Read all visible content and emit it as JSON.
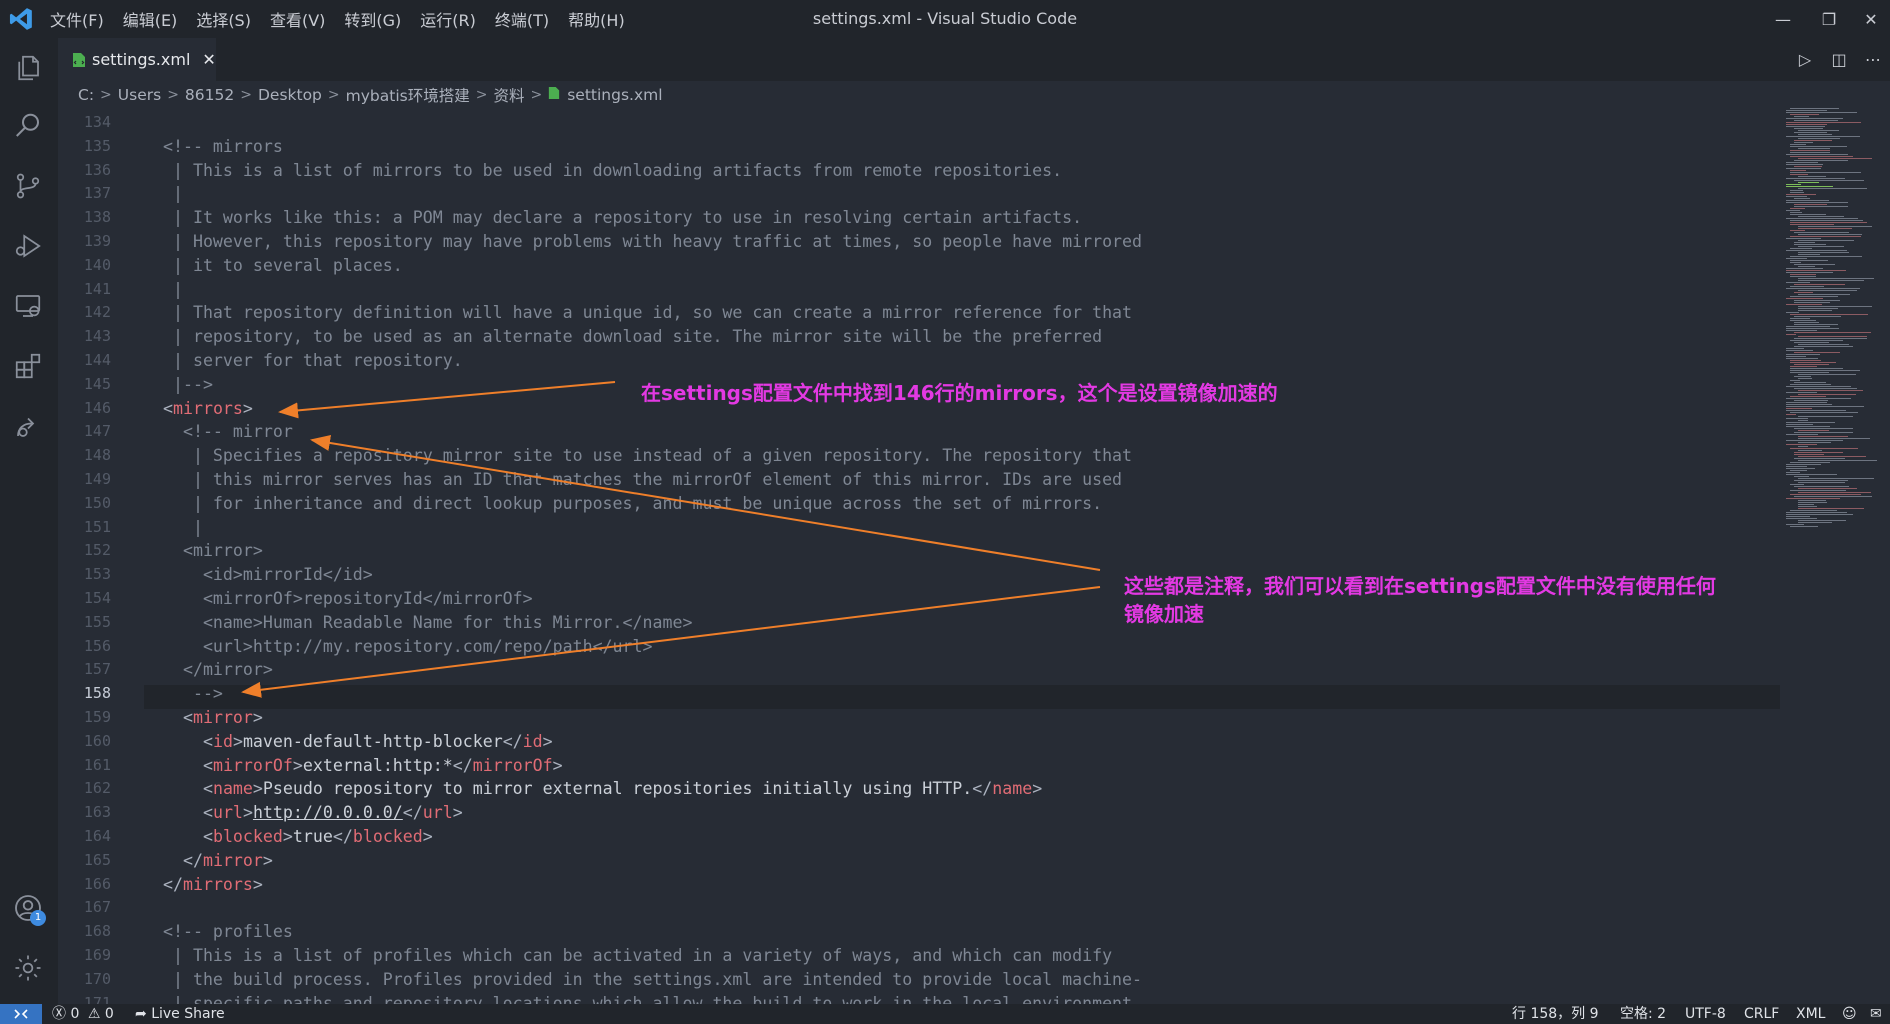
{
  "window": {
    "title": "settings.xml - Visual Studio Code"
  },
  "menu": [
    "文件(F)",
    "编辑(E)",
    "选择(S)",
    "查看(V)",
    "转到(G)",
    "运行(R)",
    "终端(T)",
    "帮助(H)"
  ],
  "tab": {
    "label": "settings.xml"
  },
  "breadcrumb": [
    "C:",
    "Users",
    "86152",
    "Desktop",
    "mybatis环境搭建",
    "资料",
    "settings.xml"
  ],
  "editor": {
    "first_line": 134,
    "current_line": 158,
    "lines": [
      "",
      "  <!-- mirrors",
      "   | This is a list of mirrors to be used in downloading artifacts from remote repositories.",
      "   |",
      "   | It works like this: a POM may declare a repository to use in resolving certain artifacts.",
      "   | However, this repository may have problems with heavy traffic at times, so people have mirrored",
      "   | it to several places.",
      "   |",
      "   | That repository definition will have a unique id, so we can create a mirror reference for that",
      "   | repository, to be used as an alternate download site. The mirror site will be the preferred",
      "   | server for that repository.",
      "   |-->",
      "  <mirrors>",
      "    <!-- mirror",
      "     | Specifies a repository mirror site to use instead of a given repository. The repository that",
      "     | this mirror serves has an ID that matches the mirrorOf element of this mirror. IDs are used",
      "     | for inheritance and direct lookup purposes, and must be unique across the set of mirrors.",
      "     |",
      "    <mirror>",
      "      <id>mirrorId</id>",
      "      <mirrorOf>repositoryId</mirrorOf>",
      "      <name>Human Readable Name for this Mirror.</name>",
      "      <url>http://my.repository.com/repo/path</url>",
      "    </mirror>",
      "     -->",
      "    <mirror>",
      "      <id>maven-default-http-blocker</id>",
      "      <mirrorOf>external:http:*</mirrorOf>",
      "      <name>Pseudo repository to mirror external repositories initially using HTTP.</name>",
      "      <url>http://0.0.0.0/</url>",
      "      <blocked>true</blocked>",
      "    </mirror>",
      "  </mirrors>",
      "",
      "  <!-- profiles",
      "   | This is a list of profiles which can be activated in a variety of ways, and which can modify",
      "   | the build process. Profiles provided in the settings.xml are intended to provide local machine-",
      "   | specific paths and repository locations which allow the build to work in the local environment."
    ]
  },
  "annotations": {
    "note1": "在settings配置文件中找到146行的mirrors，这个是设置镜像加速的",
    "note2_line1": "这些都是注释，我们可以看到在settings配置文件中没有使用任何",
    "note2_line2": "镜像加速"
  },
  "statusbar": {
    "errors": "0",
    "warnings": "0",
    "live_share": "Live Share",
    "position": "行 158，列 9",
    "spaces": "空格: 2",
    "encoding": "UTF-8",
    "eol": "CRLF",
    "language": "XML"
  },
  "accounts_badge": "1",
  "colors": {
    "annotation": "#e339e3",
    "arrow": "#ef7f2a",
    "remote": "#3573c2",
    "tag": "#e06c75"
  }
}
